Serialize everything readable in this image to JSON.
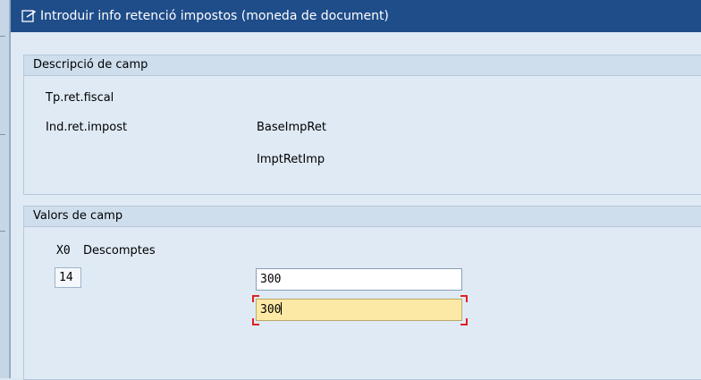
{
  "dialog": {
    "title": "Introduir info retenció impostos (moneda de document)",
    "title_icon": "edit-dialog-icon"
  },
  "field_description": {
    "header": "Descripció de camp",
    "labels": {
      "tax_type": "Tp.ret.fiscal",
      "tax_code": "Ind.ret.impost",
      "base_amount": "BaseImpRet",
      "tax_amount": "ImptRetImp"
    }
  },
  "field_values": {
    "header": "Valors de camp",
    "type_code": "X0",
    "type_text": "Descomptes",
    "tax_code_value": "14",
    "base_amount_value": "300",
    "tax_amount_value": "300"
  },
  "colors": {
    "titlebar": "#1f4d8a",
    "focus_field": "#fde9a6",
    "focus_corners": "#e02020"
  }
}
